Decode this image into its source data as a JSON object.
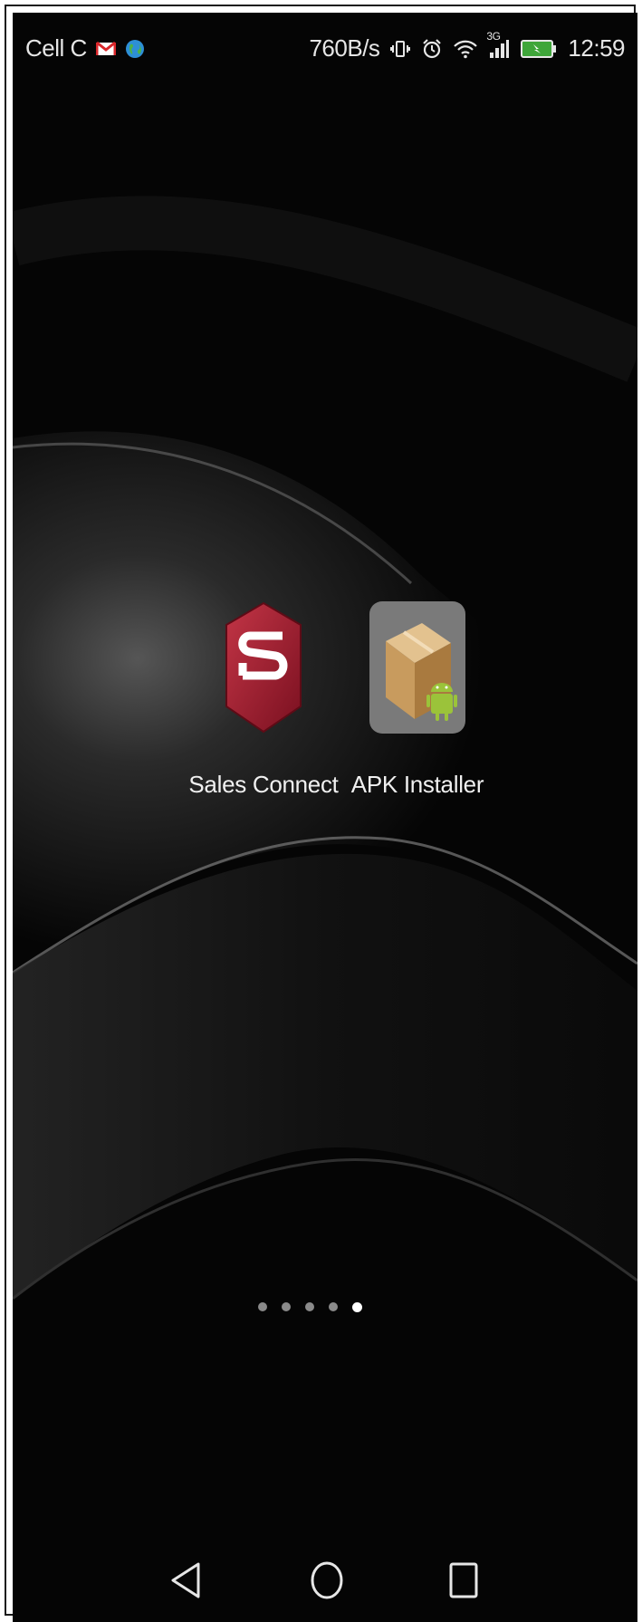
{
  "status_bar": {
    "carrier": "Cell C",
    "network_speed": "760B/s",
    "network_type": "3G",
    "time": "12:59",
    "icons": [
      "gmail-icon",
      "globe-icon",
      "vibrate-icon",
      "alarm-icon",
      "wifi-icon",
      "signal-icon",
      "battery-charging-icon"
    ]
  },
  "home_screen": {
    "apps": [
      {
        "label": "Sales Connect",
        "icon": "sales-connect-icon"
      },
      {
        "label": "APK Installer",
        "icon": "apk-installer-icon"
      }
    ],
    "pages": {
      "count": 5,
      "current": 5
    }
  },
  "nav_bar": {
    "buttons": [
      "back-icon",
      "home-icon",
      "recents-icon"
    ]
  },
  "colors": {
    "wallpaper": "#050505",
    "sales_connect_red": "#9b1b2a",
    "apk_box": "#c89b5e",
    "android_green": "#9bc33a"
  }
}
